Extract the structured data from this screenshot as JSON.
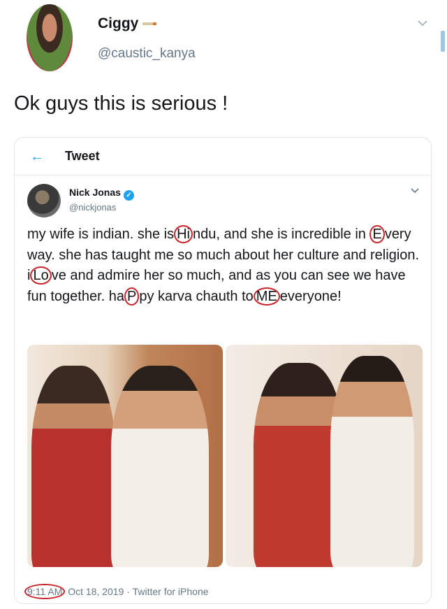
{
  "outer_tweet": {
    "display_name": "Ciggy",
    "handle": "@caustic_kanya",
    "text": "Ok guys this is serious !"
  },
  "card": {
    "header_title": "Tweet",
    "author": {
      "name": "Nick Jonas",
      "handle": "@nickjonas",
      "verified": true
    },
    "text_segments": [
      {
        "t": "my wife is indian. she is",
        "c": false
      },
      {
        "t": "Hi",
        "c": true
      },
      {
        "t": "ndu, and she is incredible in ",
        "c": false
      },
      {
        "t": "E",
        "c": true
      },
      {
        "t": "very way. she has taught me so much about her culture and religion. i",
        "c": false
      },
      {
        "t": "Lo",
        "c": true
      },
      {
        "t": "ve and admire her so much, and as you can see we have fun together. ha",
        "c": false
      },
      {
        "t": "P",
        "c": true
      },
      {
        "t": "py karva chauth to",
        "c": false
      },
      {
        "t": "ME",
        "c": true
      },
      {
        "t": "everyone!",
        "c": false
      }
    ],
    "meta": {
      "time": "9:11 AM",
      "date_source": "Oct 18, 2019 · Twitter for iPhone"
    }
  },
  "colors": {
    "accent": "#1da1f2",
    "circle_annotation": "#c8242b",
    "secondary_text": "#657786"
  },
  "icons": {
    "back": "arrow-left-icon",
    "menu": "chevron-down-icon",
    "verified": "verified-badge-icon"
  }
}
